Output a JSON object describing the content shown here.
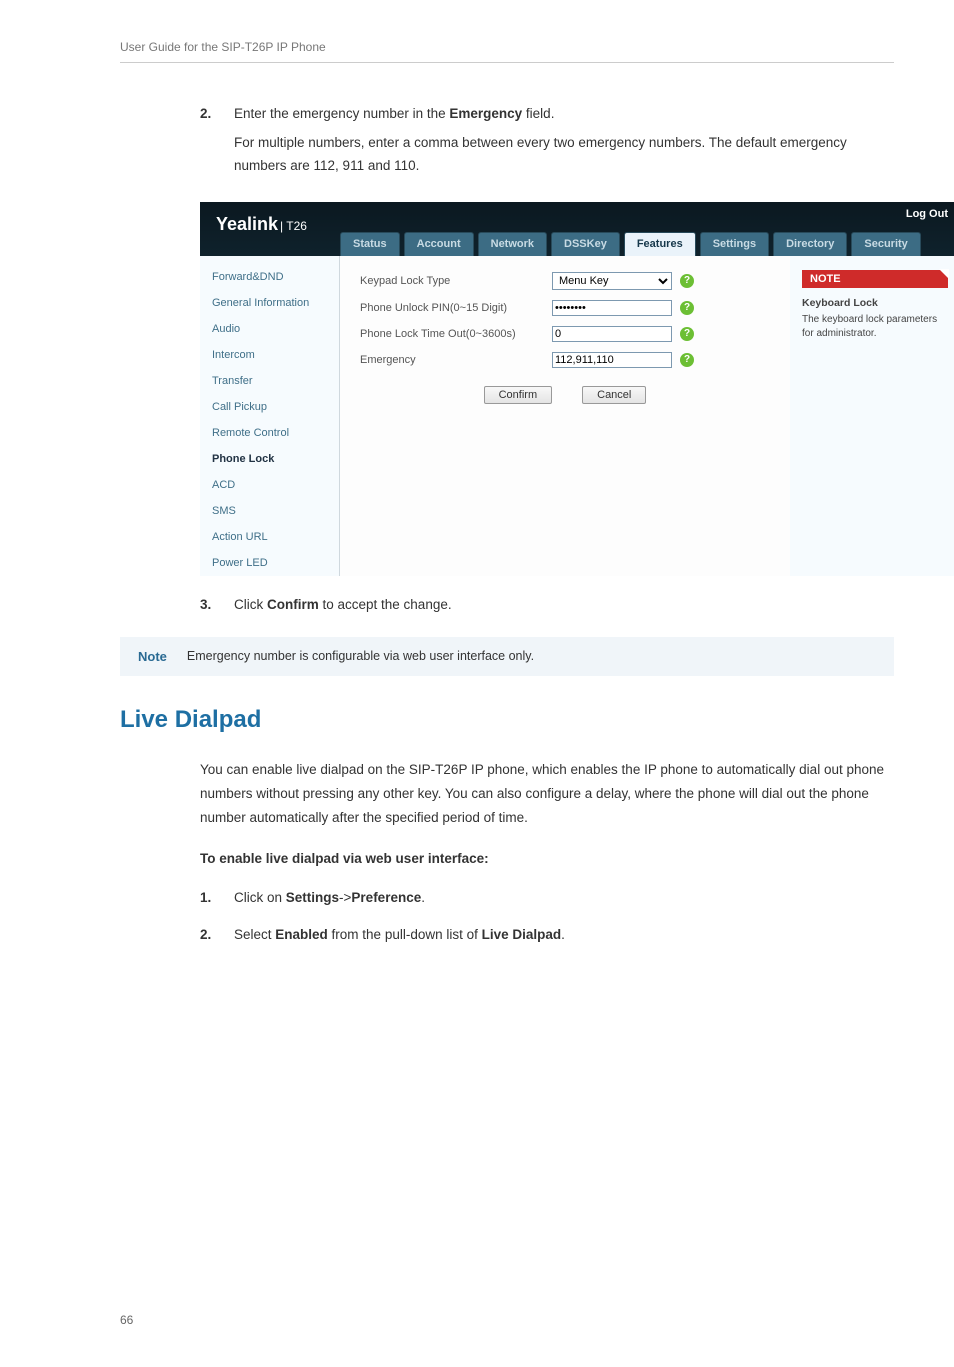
{
  "header": "User Guide for the SIP-T26P IP Phone",
  "step2": {
    "num": "2.",
    "line1_a": "Enter the emergency number in the ",
    "line1_b": "Emergency",
    "line1_c": " field.",
    "line2": "For multiple numbers, enter a comma between every two emergency numbers. The default emergency numbers are 112, 911 and 110."
  },
  "screenshot": {
    "brand": "Yealink",
    "brand_sub": "| T26",
    "logout": "Log Out",
    "tabs": [
      "Status",
      "Account",
      "Network",
      "DSSKey",
      "Features",
      "Settings",
      "Directory",
      "Security"
    ],
    "active_tab_index": 4,
    "sidebar": {
      "items": [
        {
          "label": "Forward&DND",
          "name": "forward-dnd"
        },
        {
          "label": "General Information",
          "name": "general-information"
        },
        {
          "label": "Audio",
          "name": "audio"
        },
        {
          "label": "Intercom",
          "name": "intercom"
        },
        {
          "label": "Transfer",
          "name": "transfer"
        },
        {
          "label": "Call Pickup",
          "name": "call-pickup"
        },
        {
          "label": "Remote Control",
          "name": "remote-control"
        },
        {
          "label": "Phone Lock",
          "name": "phone-lock"
        },
        {
          "label": "ACD",
          "name": "acd"
        },
        {
          "label": "SMS",
          "name": "sms"
        },
        {
          "label": "Action URL",
          "name": "action-url"
        },
        {
          "label": "Power LED",
          "name": "power-led"
        }
      ],
      "active_index": 7
    },
    "form": {
      "keypad_lock_type_label": "Keypad Lock Type",
      "keypad_lock_type_value": "Menu Key",
      "phone_unlock_pin_label": "Phone Unlock PIN(0~15 Digit)",
      "phone_unlock_pin_value": "••••••••",
      "phone_lock_timeout_label": "Phone Lock Time Out(0~3600s)",
      "phone_lock_timeout_value": "0",
      "emergency_label": "Emergency",
      "emergency_value": "112,911,110",
      "confirm": "Confirm",
      "cancel": "Cancel"
    },
    "notecol": {
      "header": "NOTE",
      "title": "Keyboard Lock",
      "body": "The keyboard lock parameters for administrator."
    }
  },
  "step3": {
    "num": "3.",
    "line_a": "Click ",
    "line_b": "Confirm",
    "line_c": " to accept the change."
  },
  "docnote": {
    "label": "Note",
    "text": "Emergency number is configurable via web user interface only."
  },
  "section_title": "Live Dialpad",
  "para1": "You can enable live dialpad on the SIP-T26P IP phone, which enables the IP phone to automatically dial out phone numbers without pressing any other key. You can also configure a delay, where the phone will dial out the phone number automatically after the specified period of time.",
  "subhead": "To enable live dialpad via web user interface:",
  "step_a": {
    "num": "1.",
    "a": "Click on ",
    "b": "Settings",
    "c": "->",
    "d": "Preference",
    "e": "."
  },
  "step_b": {
    "num": "2.",
    "a": "Select ",
    "b": "Enabled",
    "c": " from the pull-down list of ",
    "d": "Live Dialpad",
    "e": "."
  },
  "page_number": "66"
}
